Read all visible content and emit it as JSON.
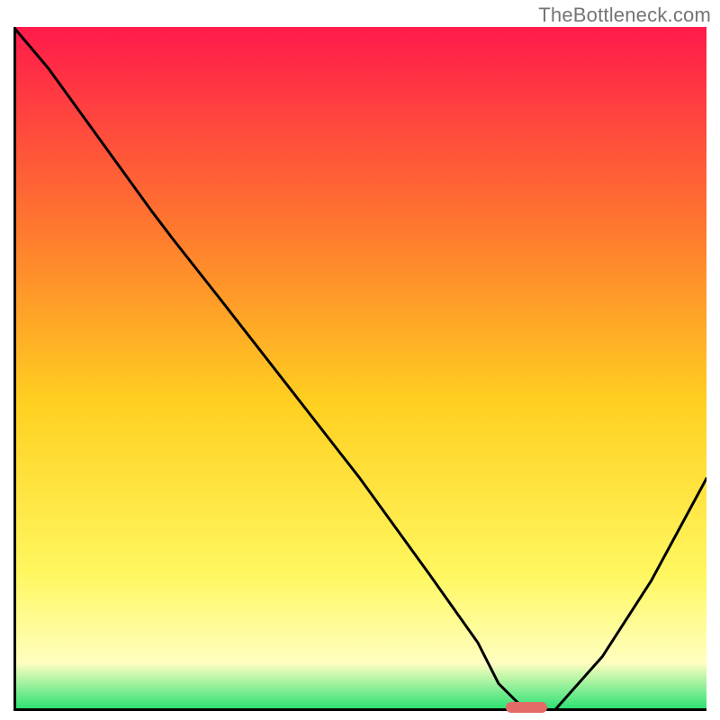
{
  "watermark": "TheBottleneck.com",
  "colors": {
    "grad_top": "#ff1a4b",
    "grad_mid_upper": "#ff7a2e",
    "grad_mid": "#ffd020",
    "grad_lower": "#fff760",
    "grad_pale": "#ffffc0",
    "grad_green": "#22e070",
    "curve": "#000000",
    "axis": "#000000",
    "marker": "#e46a67",
    "bg": "#ffffff"
  },
  "chart_data": {
    "type": "line",
    "title": "",
    "xlabel": "",
    "ylabel": "",
    "xlim": [
      0,
      100
    ],
    "ylim": [
      0,
      100
    ],
    "x": [
      0,
      5,
      10,
      15,
      20,
      23,
      30,
      40,
      50,
      60,
      67,
      70,
      73,
      78,
      85,
      92,
      100
    ],
    "y": [
      100,
      94,
      87,
      80,
      73,
      69,
      60,
      47,
      34,
      20,
      10,
      4,
      1,
      0,
      8,
      19,
      34
    ],
    "optimum_x_range": [
      70,
      78
    ],
    "marker": {
      "x": 74,
      "y": 0,
      "w": 6,
      "h": 1.5
    },
    "note": "Axes unlabeled in source. x/y normalized 0–100; y is distance-from-baseline (0 = green baseline, 100 = top)."
  }
}
